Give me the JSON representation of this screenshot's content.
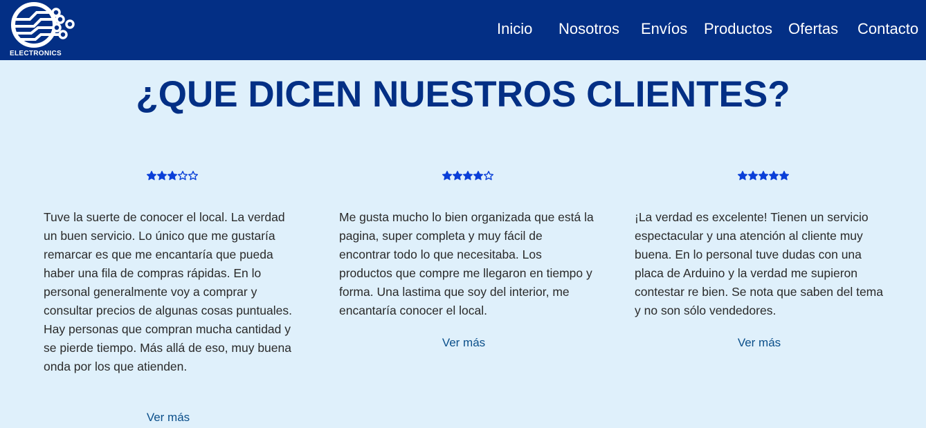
{
  "brand": {
    "logo_text": "ELECTRONICS"
  },
  "nav": {
    "items": [
      {
        "label": "Inicio"
      },
      {
        "label": "Nosotros"
      },
      {
        "label": "Envíos"
      },
      {
        "label": "Productos"
      },
      {
        "label": "Ofertas"
      },
      {
        "label": "Contacto"
      }
    ]
  },
  "heading": "¿QUE DICEN NUESTROS CLIENTES?",
  "testimonials": [
    {
      "rating": 3,
      "max_rating": 5,
      "text": "Tuve la suerte de conocer el local. La verdad un buen servicio. Lo único que me gustaría remarcar es que me encantaría que pueda haber una fila de compras rápidas. En lo personal generalmente voy a comprar y consultar precios de algunas cosas puntuales. Hay personas que compran mucha cantidad y se pierde tiempo. Más allá de eso, muy buena onda por los que atienden.",
      "more_label": "Ver más"
    },
    {
      "rating": 4,
      "max_rating": 5,
      "text": "Me gusta mucho lo bien organizada que está la pagina, super completa y muy fácil de encontrar todo lo que necesitaba. Los productos que compre me llegaron en tiempo y forma. Una lastima que soy del interior, me encantaría conocer el local.",
      "more_label": "Ver más"
    },
    {
      "rating": 5,
      "max_rating": 5,
      "text": "¡La verdad es excelente! Tienen un servicio espectacular y una atención al cliente muy buena. En lo personal tuve dudas con una placa de Arduino y la verdad me supieron contestar re bien. Se nota que saben del tema y no son sólo vendedores.",
      "more_label": "Ver más"
    }
  ],
  "colors": {
    "navbar": "#032f85",
    "background": "#dff0fb",
    "heading": "#032f85",
    "star": "#0a3fd8",
    "link": "#0b4f8a"
  }
}
